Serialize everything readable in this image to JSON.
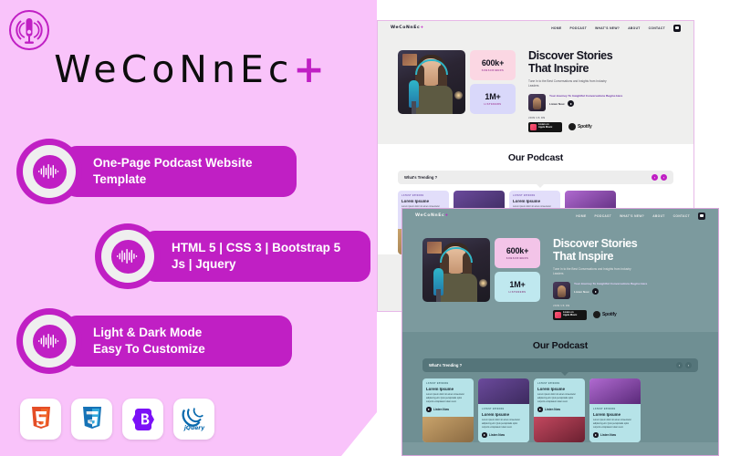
{
  "theme": {
    "pink_bg": "#f9c3fa",
    "purple": "#c01fc4",
    "dark_preview_bg": "#7c9a9e",
    "light_preview_bg": "#efefee"
  },
  "left_panel": {
    "logo_icon": "podcast-microphone-icon",
    "brand_name": "WeCoNnEc",
    "brand_plus": "+",
    "badges": [
      {
        "icon": "audio-waveform-icon",
        "line1": "One-Page Podcast Website",
        "line2": "Template"
      },
      {
        "icon": "audio-waveform-icon",
        "line1": "HTML 5 | CSS 3 | Bootstrap 5",
        "line2": "Js | Jquery"
      },
      {
        "icon": "audio-waveform-icon",
        "line1": "Light & Dark Mode",
        "line2": "Easy To Customize"
      }
    ],
    "tech_icons": [
      {
        "name": "html5-icon",
        "label": "5"
      },
      {
        "name": "css3-icon",
        "label": "3"
      },
      {
        "name": "bootstrap-icon",
        "label": "B"
      },
      {
        "name": "jquery-icon",
        "label": "jQuery"
      }
    ]
  },
  "preview": {
    "nav": {
      "logo": "WeCoNnEc",
      "logo_plus": "+",
      "menu": [
        "HOME",
        "PODCAST",
        "WHAT'S NEW?",
        "ABOUT",
        "CONTACT"
      ],
      "theme_toggle": "theme-toggle-icon"
    },
    "hero": {
      "image_alt": "podcast-host-photo",
      "stats": [
        {
          "value": "600k+",
          "label": "SUBSCRIBERS"
        },
        {
          "value": "1M+",
          "label": "LISTENERS"
        }
      ],
      "heading_line1": "Discover Stories",
      "heading_line2": "That Inspire",
      "subtitle": "Tune In to the Best Conversations and Insights from Industry Leaders",
      "episode": {
        "title": "Your Journey To Insightful Conversations Begins Here",
        "listen_label": "Listen Now",
        "play_icon": "play-icon"
      },
      "join_label": "JOIN US ON",
      "stores": [
        {
          "name": "apple-music-badge",
          "small": "Listen on",
          "big": "Apple Music"
        },
        {
          "name": "spotify-badge",
          "label": "Spotify"
        }
      ]
    },
    "podcast_section": {
      "title": "Our Podcast",
      "trending_label": "What's Trending ?",
      "prev_icon": "‹",
      "next_icon": "›",
      "cards": [
        {
          "eyebrow": "LATEST EPISODE",
          "title": "Lorem Ipsume",
          "desc": "Lorem ipsum dolor sit amet consectetur adipiscing elit. Quis perspiciatis optio corporis voluptatem totam sunt.",
          "link": "Listen Now"
        },
        {
          "eyebrow": "LATEST EPISODE",
          "title": "Lorem Ipsume",
          "desc": "Lorem ipsum dolor sit amet consectetur adipiscing elit. Quis perspiciatis optio corporis voluptatem totam sunt.",
          "link": "Listen Now"
        },
        {
          "eyebrow": "LATEST EPISODE",
          "title": "Lorem Ipsume",
          "desc": "Lorem ipsum dolor sit amet consectetur adipiscing elit. Quis perspiciatis optio corporis voluptatem totam sunt.",
          "link": "Listen Now"
        },
        {
          "eyebrow": "LATEST EPISODE",
          "title": "Lorem Ipsume",
          "desc": "Lorem ipsum dolor sit amet consectetur adipiscing elit. Quis perspiciatis optio corporis voluptatem totam sunt.",
          "link": "Listen Now"
        }
      ]
    }
  }
}
